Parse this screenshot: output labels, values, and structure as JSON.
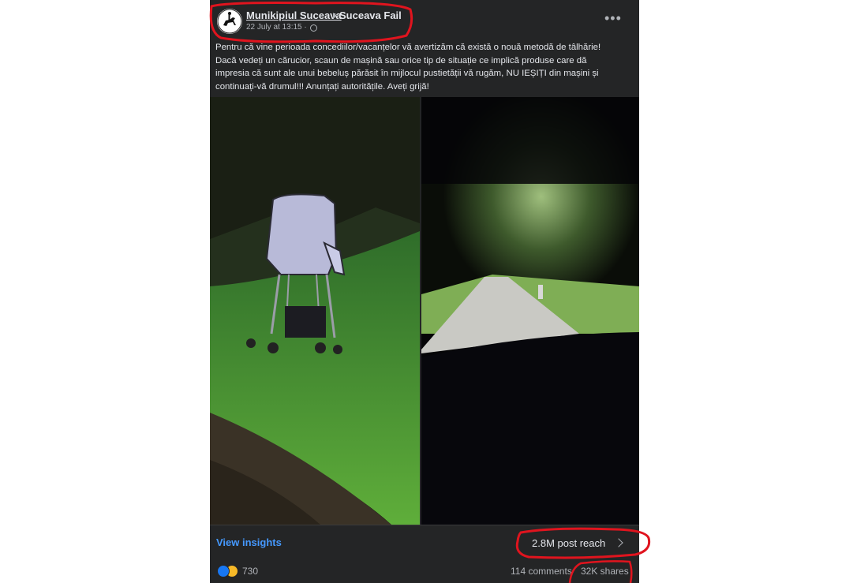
{
  "post": {
    "page_name": "Munikipiul Suceava",
    "group_name": "Suceava Fail",
    "timestamp": "22 July at 13:15 ·",
    "more_icon": "more-horizontal-icon",
    "text_lines": [
      "Pentru că vine perioada concediilor/vacanțelor vă avertizăm că există o nouă metodă de tâlhărie!",
      "Dacă vedeți un cărucior, scaun de mașină sau orice tip de situație ce implică produse  care dă",
      "impresia că sunt ale unui bebeluș părăsit în mijlocul pustietății vă rugăm, NU IEȘIȚI din mașini și",
      "continuați-vă drumul!!! Anunțați autoritățile. Aveți grijă!"
    ]
  },
  "footer": {
    "insights_label": "View insights",
    "reach_label": "2.8M post reach",
    "reactions_count": "730",
    "comments_label": "114 comments",
    "shares_label": "32K shares"
  },
  "colors": {
    "post_background": "#242526",
    "link_blue": "#4599ff",
    "annotation_red": "#e0141e"
  }
}
